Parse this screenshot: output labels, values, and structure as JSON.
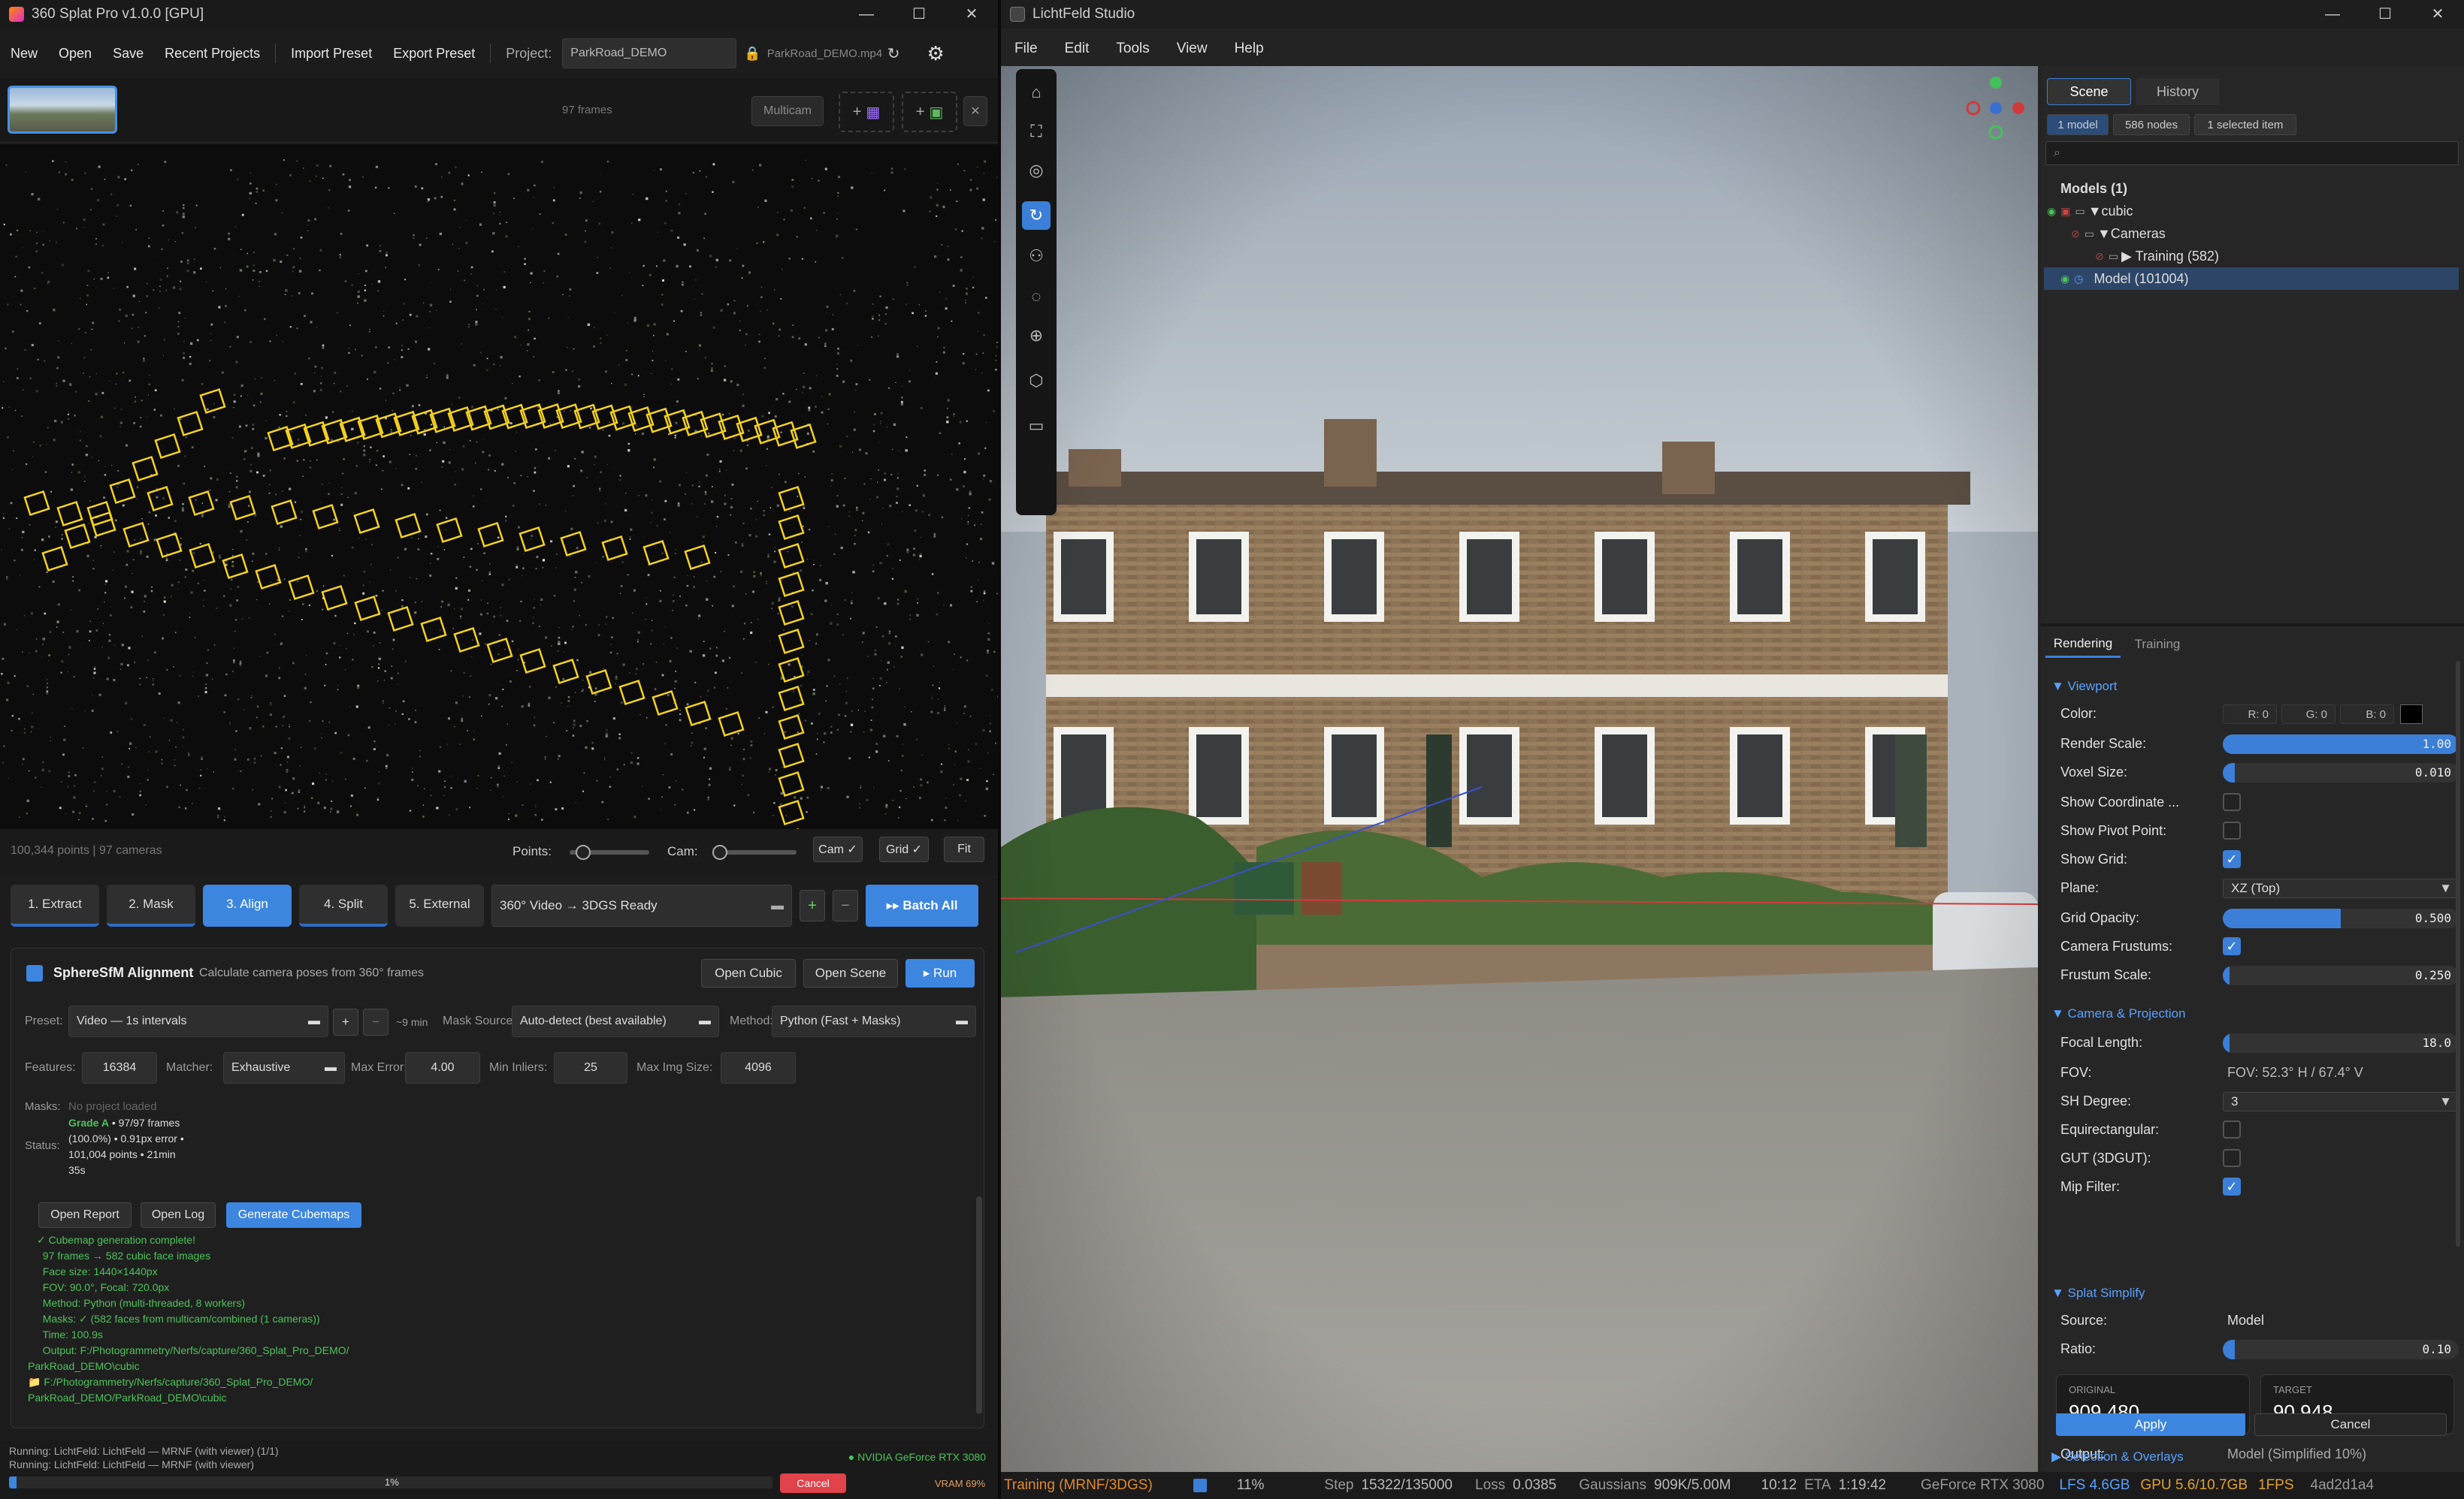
{
  "left_app": {
    "title": "360 Splat Pro v1.0.0 [GPU]",
    "menu": [
      "New",
      "Open",
      "Save",
      "Recent Projects",
      "Import Preset",
      "Export Preset"
    ],
    "project_label": "Project:",
    "project_value": "ParkRoad_DEMO",
    "video_file": "ParkRoad_DEMO.mp4",
    "frames_count": "97 frames",
    "multicam_label": "Multicam",
    "add_label": "+",
    "pc_status": "100,344 points | 97 cameras",
    "points_label": "Points:",
    "cam_label": "Cam:",
    "cam_toggle": "Cam ✓",
    "grid_toggle": "Grid ✓",
    "fit_button": "Fit",
    "steps": [
      "1. Extract",
      "2. Mask",
      "3. Align",
      "4. Split",
      "5. External"
    ],
    "active_step": "3. Align",
    "pipeline_select": "360° Video → 3DGS Ready",
    "plus": "+",
    "minus": "−",
    "batch_all": "▸▸ Batch All",
    "panel": {
      "title": "SphereSfM Alignment",
      "subtitle": "Calculate camera poses from 360° frames",
      "open_cubic": "Open Cubic",
      "open_scene": "Open Scene",
      "run": "▸ Run",
      "preset_label": "Preset:",
      "preset_value": "Video — 1s intervals",
      "time_est": "~9 min",
      "mask_source_label": "Mask Source:",
      "mask_source_value": "Auto-detect (best available)",
      "method_label": "Method:",
      "method_value": "Python (Fast + Masks)",
      "features_label": "Features:",
      "features_value": "16384",
      "matcher_label": "Matcher:",
      "matcher_value": "Exhaustive",
      "max_error_label": "Max Error:",
      "max_error_value": "4.00",
      "min_inliers_label": "Min Inliers:",
      "min_inliers_value": "25",
      "max_img_label": "Max Img Size:",
      "max_img_value": "4096",
      "masks_label": "Masks:",
      "masks_value": "No project loaded",
      "status_label": "Status:",
      "status_grade": "Grade A",
      "status_lines": [
        " • 97/97 frames",
        "(100.0%) • 0.91px error •",
        "101,004 points • 21min",
        "35s"
      ],
      "open_report": "Open Report",
      "open_log": "Open Log",
      "generate_cubemaps": "Generate Cubemaps",
      "log": [
        "✓ Cubemap generation complete!",
        "  97 frames → 582 cubic face images",
        "  Face size: 1440×1440px",
        "  FOV: 90.0°, Focal: 720.0px",
        "  Method: Python (multi-threaded, 8 workers)",
        "  Masks: ✓ (582 faces from multicam/combined (1 cameras))",
        "  Time: 100.9s",
        "  Output: F:/Photogrammetry/Nerfs/capture/360_Splat_Pro_DEMO/",
        "ParkRoad_DEMO\\cubic",
        "📁 F:/Photogrammetry/Nerfs/capture/360_Splat_Pro_DEMO/",
        "ParkRoad_DEMO/ParkRoad_DEMO\\cubic"
      ]
    },
    "running1": "Running: LichtFeld: LichtFeld — MRNF (with viewer) (1/1)",
    "running2": "Running: LichtFeld: LichtFeld — MRNF (with viewer)",
    "gpu": "● NVIDIA GeForce RTX 3080",
    "progress_pct": "1%",
    "progress_value": 0.01,
    "cancel": "Cancel",
    "vram": "VRAM 69%"
  },
  "right_app": {
    "title": "LichtFeld Studio",
    "menu": [
      "File",
      "Edit",
      "Tools",
      "View",
      "Help"
    ],
    "tabs": [
      "Scene",
      "History"
    ],
    "chips": [
      "1 model",
      "586 nodes",
      "1 selected item"
    ],
    "tree": {
      "header": "Models (1)",
      "cubic": "▼cubic",
      "cameras": "▼Cameras",
      "training": "▶ Training (582)",
      "model": "Model (101004)"
    },
    "subtabs": [
      "Rendering",
      "Training"
    ],
    "viewport_section": "▼ Viewport",
    "color_label": "Color:",
    "color_r": "R: 0",
    "color_g": "G: 0",
    "color_b": "B: 0",
    "render_scale_label": "Render Scale:",
    "render_scale": "1.00",
    "voxel_size_label": "Voxel Size:",
    "voxel_size": "0.010",
    "show_coord_label": "Show Coordinate ...",
    "show_pivot_label": "Show Pivot Point:",
    "show_grid_label": "Show Grid:",
    "plane_label": "Plane:",
    "plane_value": "XZ (Top)",
    "grid_opacity_label": "Grid Opacity:",
    "grid_opacity": "0.500",
    "camera_frustums_label": "Camera Frustums:",
    "frustum_scale_label": "Frustum Scale:",
    "frustum_scale": "0.250",
    "camproj_section": "▼ Camera & Projection",
    "focal_label": "Focal Length:",
    "focal_value": "18.0",
    "fov_label": "FOV:",
    "fov_value": "FOV: 52.3° H / 67.4° V",
    "sh_label": "SH Degree:",
    "sh_value": "3",
    "equirect_label": "Equirectangular:",
    "gut_label": "GUT (3DGUT):",
    "mip_label": "Mip Filter:",
    "simplify_section": "▼ Splat Simplify",
    "source_label": "Source:",
    "source_value": "Model",
    "ratio_label": "Ratio:",
    "ratio_value": "0.10",
    "original_label": "ORIGINAL",
    "original_value": "909,480",
    "target_label": "TARGET",
    "target_value": "90,948",
    "output_label": "Output:",
    "output_value": "Model (Simplified 10%)",
    "apply": "Apply",
    "cancel": "Cancel",
    "selection_section": "▶ Selection & Overlays",
    "status": {
      "mode": "Training (MRNF/3DGS)",
      "pct": "11%",
      "step_label": "Step",
      "step": "15322/135000",
      "loss_label": "Loss",
      "loss": "0.0385",
      "gauss_label": "Gaussians",
      "gauss": "909K/5.00M",
      "time": "10:12",
      "eta_label": "ETA",
      "eta": "1:19:42",
      "gpu": "GeForce RTX 3080",
      "lfs": "LFS 4.6GB",
      "gpu_mem": "GPU 5.6/10.7GB",
      "fps": "1FPS",
      "hash": "4ad2d1a4"
    }
  },
  "colors": {
    "accent": "#3d86e0",
    "green_log": "#4cc35a",
    "camera_frame": "#f4d21c"
  }
}
